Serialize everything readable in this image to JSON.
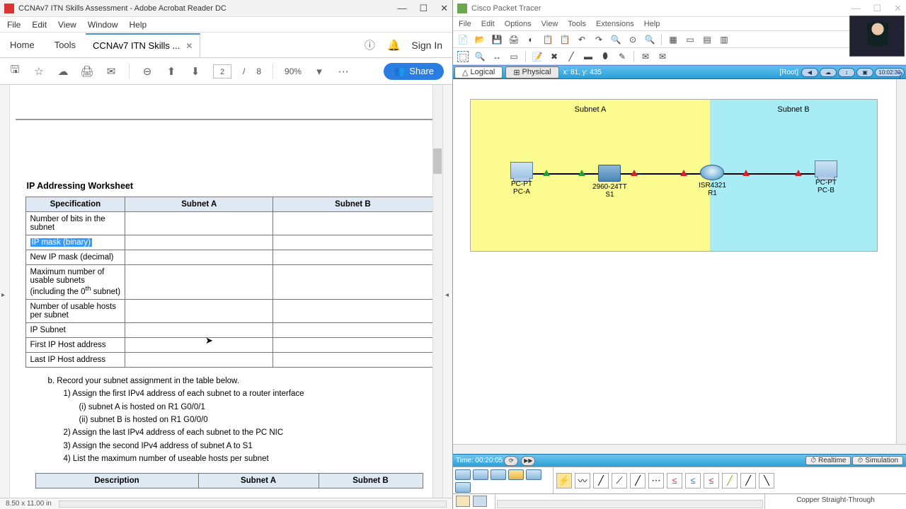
{
  "adobe": {
    "title": "CCNAv7 ITN Skills Assessment - Adobe Acrobat Reader DC",
    "menu": [
      "File",
      "Edit",
      "View",
      "Window",
      "Help"
    ],
    "tab_home": "Home",
    "tab_tools": "Tools",
    "tab_file": "CCNAv7 ITN Skills ...",
    "signin": "Sign In",
    "page_current": "2",
    "page_sep": "/",
    "page_total": "8",
    "zoom": "90%",
    "share": "Share",
    "status_dim": "8.50 x 11.00 in"
  },
  "doc": {
    "wks_title": "IP Addressing Worksheet",
    "headers": {
      "spec": "Specification",
      "a": "Subnet A",
      "b": "Subnet B"
    },
    "rows": {
      "r1": "Number of bits in the subnet",
      "r2": "IP mask (binary)",
      "r3": "New IP mask (decimal)",
      "r4a": "Maximum number of usable subnets (including the 0",
      "r4b": "th",
      "r4c": " subnet)",
      "r5": "Number of usable hosts per subnet",
      "r6": "IP Subnet",
      "r7": "First IP Host address",
      "r8": "Last IP Host address"
    },
    "instr_b": "b.   Record your subnet assignment in the table below.",
    "instr_1": "1)   Assign the first IPv4 address of each subnet to a router interface",
    "instr_1i": "(i)    subnet A is hosted on R1 G0/0/1",
    "instr_1ii": "(ii)   subnet B is hosted on R1 G0/0/0",
    "instr_2": "2)   Assign the last IPv4 address of each subnet to the PC NIC",
    "instr_3": "3)   Assign the second IPv4 address of subnet A to S1",
    "instr_4": "4)   List the maximum number of useable hosts per subnet",
    "desc_headers": {
      "d": "Description",
      "a": "Subnet A",
      "b": "Subnet B"
    }
  },
  "pt": {
    "title": "Cisco Packet Tracer",
    "menu": [
      "File",
      "Edit",
      "Options",
      "View",
      "Tools",
      "Extensions",
      "Help"
    ],
    "tab_logical": "Logical",
    "tab_physical": "Physical",
    "coord": "x: 81, y: 435",
    "root": "[Root]",
    "clock": "10:02:30",
    "subnet_a": "Subnet A",
    "subnet_b": "Subnet B",
    "pca_type": "PC-PT",
    "pca_name": "PC-A",
    "sw_type": "2960-24TT",
    "sw_name": "S1",
    "rt_type": "ISR4321",
    "rt_name": "R1",
    "pcb_type": "PC-PT",
    "pcb_name": "PC-B",
    "time_label": "Time: 00:20:05",
    "mode_rt": "Realtime",
    "mode_sim": "Simulation",
    "conn_name": "Copper Straight-Through"
  }
}
